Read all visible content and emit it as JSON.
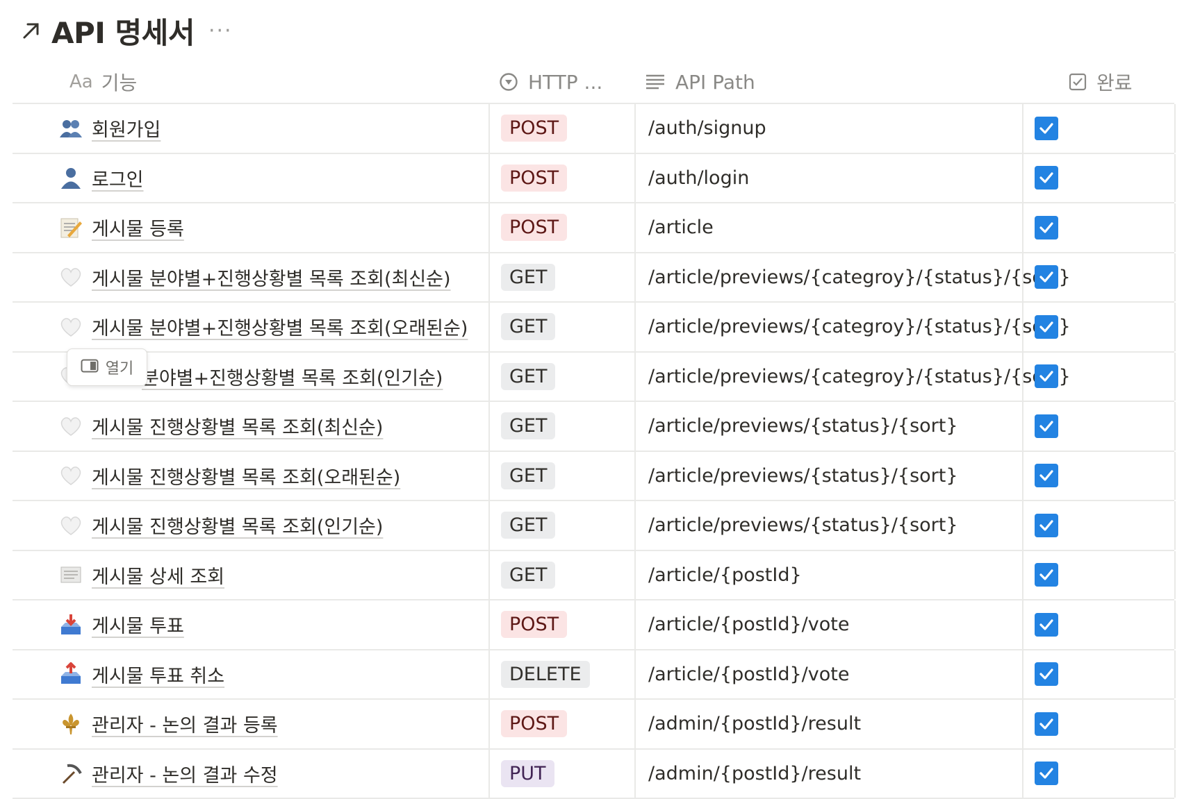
{
  "title": "API 명세서",
  "more_menu": "···",
  "columns": {
    "feature": {
      "prefix": "Aa",
      "label": "기능"
    },
    "method": {
      "label": "HTTP ..."
    },
    "path": {
      "label": "API Path"
    },
    "done": {
      "label": "완료"
    }
  },
  "colors": {
    "POST": {
      "bg": "#fbe4e4",
      "fg": "#5d1715"
    },
    "GET": {
      "bg": "#ebeced",
      "fg": "#32302c"
    },
    "DELETE": {
      "bg": "#ebeced",
      "fg": "#32302c"
    },
    "PUT": {
      "bg": "#eae4f2",
      "fg": "#412454"
    },
    "checkbox": "#2383e2"
  },
  "tooltip": {
    "label": "열기"
  },
  "rows": [
    {
      "icon": "two-people-icon",
      "name": "회원가입",
      "method": "POST",
      "path": "/auth/signup",
      "done": true
    },
    {
      "icon": "person-icon",
      "name": "로그인",
      "method": "POST",
      "path": "/auth/login",
      "done": true
    },
    {
      "icon": "memo-icon",
      "name": "게시물 등록",
      "method": "POST",
      "path": "/article",
      "done": true
    },
    {
      "icon": "white-heart-icon",
      "name": "게시물 분야별+진행상황별 목록 조회(최신순)",
      "method": "GET",
      "path": "/article/previews/{categroy}/{status}/{sort}",
      "done": true
    },
    {
      "icon": "white-heart-icon",
      "name": "게시물 분야별+진행상황별 목록 조회(오래된순)",
      "method": "GET",
      "path": "/article/previews/{categroy}/{status}/{sort}",
      "done": true
    },
    {
      "icon": "white-heart-icon",
      "name": "분야별+진행상황별 목록 조회(인기순)",
      "method": "GET",
      "path": "/article/previews/{categroy}/{status}/{sort}",
      "done": true
    },
    {
      "icon": "white-heart-icon",
      "name": "게시물 진행상황별 목록 조회(최신순)",
      "method": "GET",
      "path": "/article/previews/{status}/{sort}",
      "done": true
    },
    {
      "icon": "white-heart-icon",
      "name": "게시물 진행상황별 목록 조회(오래된순)",
      "method": "GET",
      "path": "/article/previews/{status}/{sort}",
      "done": true
    },
    {
      "icon": "white-heart-icon",
      "name": "게시물 진행상황별 목록 조회(인기순)",
      "method": "GET",
      "path": "/article/previews/{status}/{sort}",
      "done": true
    },
    {
      "icon": "page-icon",
      "name": "게시물 상세 조회",
      "method": "GET",
      "path": "/article/{postId}",
      "done": true
    },
    {
      "icon": "inbox-tray-icon",
      "name": "게시물 투표",
      "method": "POST",
      "path": "/article/{postId}/vote",
      "done": true
    },
    {
      "icon": "outbox-tray-icon",
      "name": "게시물 투표 취소",
      "method": "DELETE",
      "path": "/article/{postId}/vote",
      "done": true
    },
    {
      "icon": "fleur-de-lis-icon",
      "name": "관리자 - 논의 결과 등록",
      "method": "POST",
      "path": "/admin/{postId}/result",
      "done": true
    },
    {
      "icon": "pick-icon",
      "name": "관리자 - 논의 결과 수정",
      "method": "PUT",
      "path": "/admin/{postId}/result",
      "done": true
    }
  ]
}
